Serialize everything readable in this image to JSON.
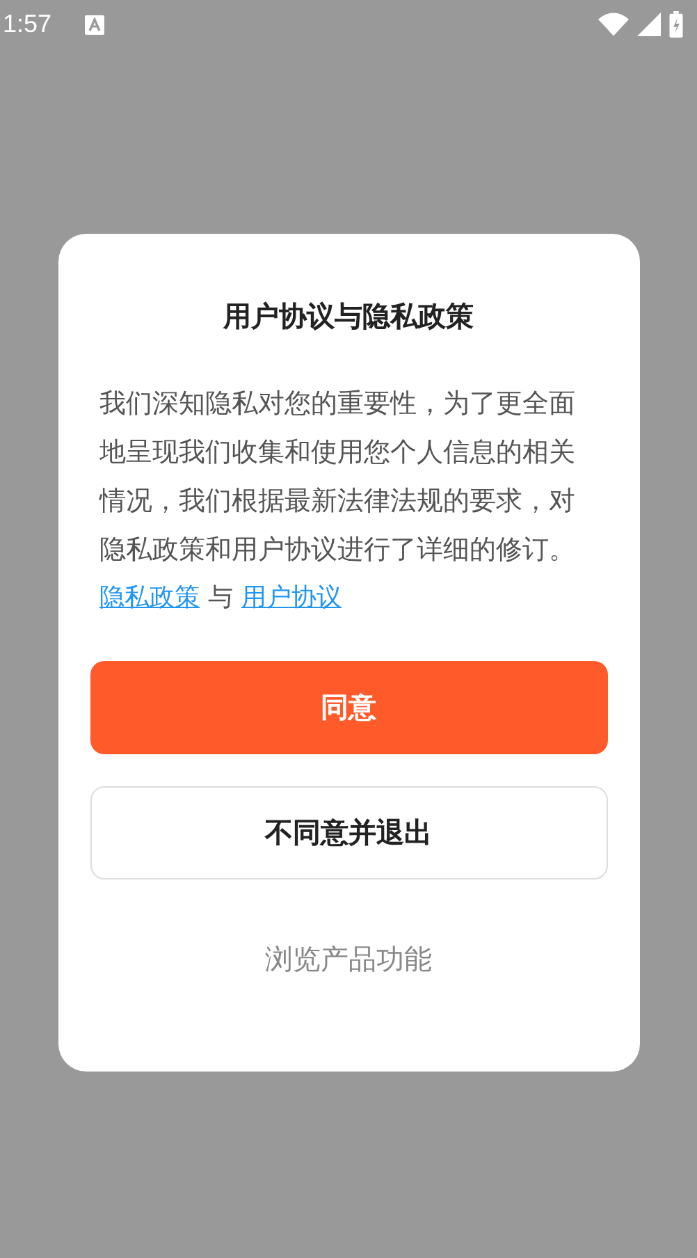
{
  "status_bar": {
    "time": "1:57"
  },
  "dialog": {
    "title": "用户协议与隐私政策",
    "body": "我们深知隐私对您的重要性，为了更全面地呈现我们收集和使用您个人信息的相关情况，我们根据最新法律法规的要求，对隐私政策和用户协议进行了详细的修订。",
    "links": [
      {
        "kind": "link",
        "text": "隐私政策"
      },
      {
        "kind": "separator",
        "text": "与"
      },
      {
        "kind": "link",
        "text": "用户协议"
      }
    ],
    "buttons": [
      {
        "kind": "primary",
        "label": "同意"
      },
      {
        "kind": "outline",
        "label": "不同意并退出"
      },
      {
        "kind": "text",
        "label": "浏览产品功能"
      }
    ]
  }
}
